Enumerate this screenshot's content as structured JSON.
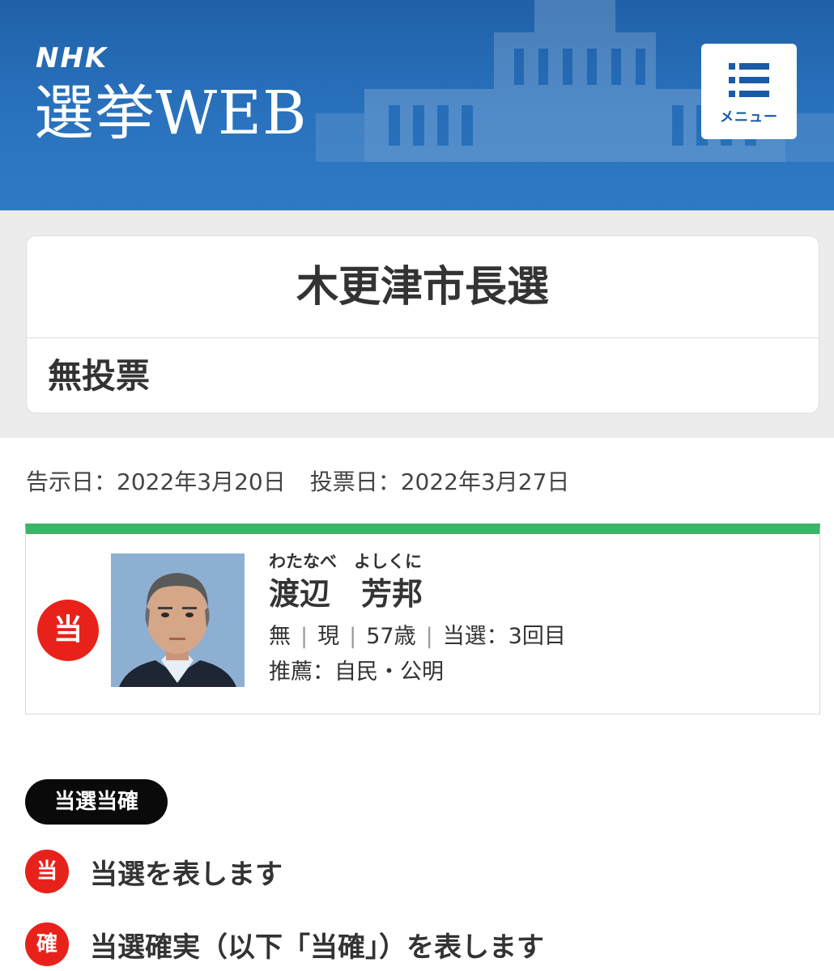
{
  "header": {
    "brand_small": "NHK",
    "brand_title": "選挙WEB",
    "menu_label": "メニュー",
    "menu_icon": "list-menu-icon"
  },
  "election": {
    "title": "木更津市長選",
    "status": "無投票"
  },
  "dates": {
    "announcement": "告示日：2022年3月20日",
    "voting": "投票日：2022年3月27日"
  },
  "candidate": {
    "result_badge": "当",
    "furigana": "わたなべ　よしくに",
    "name": "渡辺　芳邦",
    "affiliation": "無",
    "status": "現",
    "age": "57歳",
    "terms": "当選：3回目",
    "endorsement": "推薦：自民・公明",
    "accent_color": "#3cb569",
    "badge_color": "#e8221a"
  },
  "legend": {
    "heading": "当選当確",
    "items": [
      {
        "badge": "当",
        "text": "当選を表します"
      },
      {
        "badge": "確",
        "text": "当選確実（以下「当確」）を表します"
      }
    ]
  }
}
